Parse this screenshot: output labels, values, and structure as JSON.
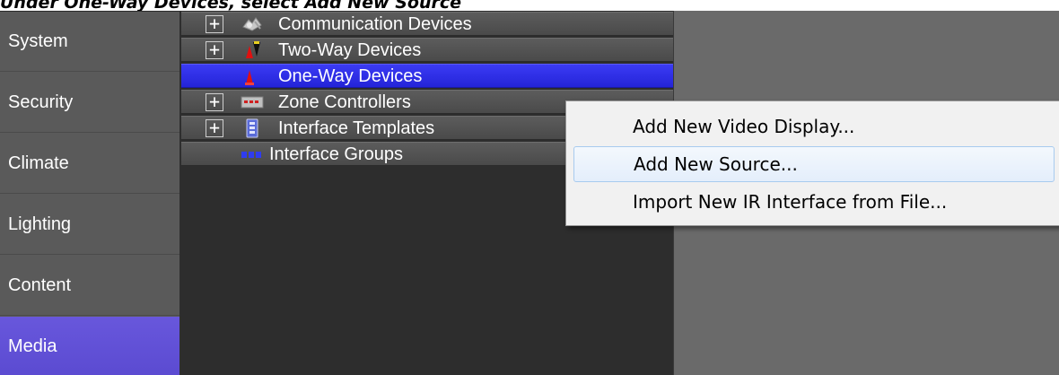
{
  "caption": "Under One-Way Devices, select Add New Source",
  "sidebar": {
    "items": [
      {
        "label": "System"
      },
      {
        "label": "Security"
      },
      {
        "label": "Climate"
      },
      {
        "label": "Lighting"
      },
      {
        "label": "Content"
      },
      {
        "label": "Media",
        "active": true
      }
    ]
  },
  "tree": {
    "rows": [
      {
        "label": "Communication Devices",
        "expander": "+",
        "icon": "communication-devices-icon"
      },
      {
        "label": "Two-Way Devices",
        "expander": "+",
        "icon": "two-way-devices-icon"
      },
      {
        "label": "One-Way Devices",
        "expander": "",
        "icon": "one-way-devices-icon",
        "selected": true
      },
      {
        "label": "Zone Controllers",
        "expander": "+",
        "icon": "zone-controllers-icon"
      },
      {
        "label": "Interface Templates",
        "expander": "+",
        "icon": "interface-templates-icon"
      },
      {
        "label": "Interface Groups",
        "expander": "",
        "icon": "interface-groups-icon"
      }
    ]
  },
  "context_menu": {
    "items": [
      {
        "label": "Add New Video Display..."
      },
      {
        "label": "Add New Source...",
        "hover": true
      },
      {
        "label": "Import New IR Interface from File..."
      }
    ]
  },
  "colors": {
    "sidebar_active": "#6857dc",
    "tree_selected": "#2a2ae0",
    "menu_hover_border": "#a8cbef"
  }
}
